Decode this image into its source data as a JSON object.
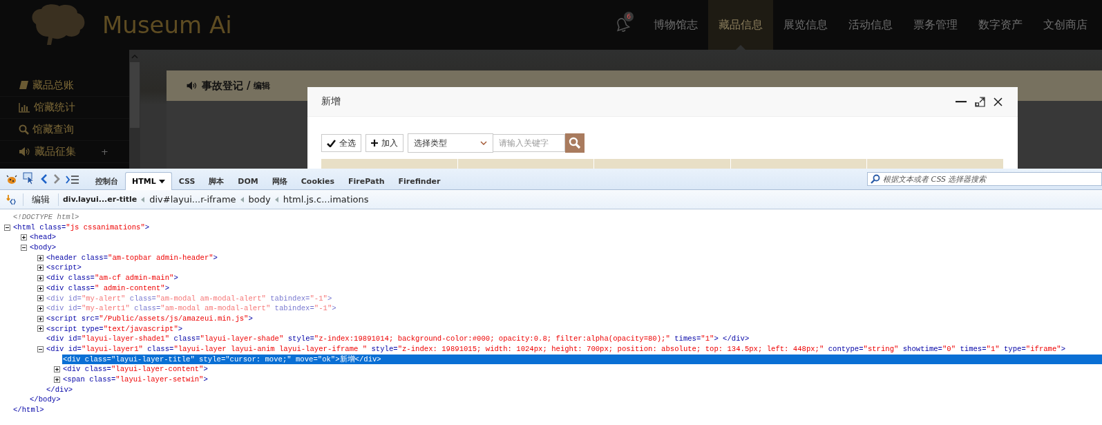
{
  "app": {
    "logo": "Museum Ai",
    "notification_count": "6",
    "nav": [
      {
        "label": "博物馆志",
        "selected": false
      },
      {
        "label": "藏品信息",
        "selected": true
      },
      {
        "label": "展览信息",
        "selected": false
      },
      {
        "label": "活动信息",
        "selected": false
      },
      {
        "label": "票务管理",
        "selected": false
      },
      {
        "label": "数字资产",
        "selected": false
      },
      {
        "label": "文创商店",
        "selected": false
      }
    ],
    "sidebar": [
      {
        "kind": "book",
        "label": "藏品总账"
      },
      {
        "kind": "chart",
        "label": "馆藏统计"
      },
      {
        "kind": "search",
        "label": "馆藏查询"
      },
      {
        "kind": "sound",
        "label": "藏品征集",
        "expander": "+"
      }
    ],
    "card": {
      "title": "事故登记",
      "separator": "/",
      "subtitle": "编辑"
    },
    "modal": {
      "title": "新增",
      "select_all": "全选",
      "add": "加入",
      "type_select": "选择类型",
      "keyword_placeholder": "请输入关键字"
    }
  },
  "devtools": {
    "tabs": [
      {
        "label": "控制台",
        "selected": false,
        "menu": false
      },
      {
        "label": "HTML",
        "selected": true,
        "menu": true
      },
      {
        "label": "CSS",
        "selected": false,
        "menu": false
      },
      {
        "label": "脚本",
        "selected": false,
        "menu": false
      },
      {
        "label": "DOM",
        "selected": false,
        "menu": false
      },
      {
        "label": "网络",
        "selected": false,
        "menu": false
      },
      {
        "label": "Cookies",
        "selected": false,
        "menu": false
      },
      {
        "label": "FirePath",
        "selected": false,
        "menu": false
      },
      {
        "label": "Firefinder",
        "selected": false,
        "menu": false
      }
    ],
    "search_placeholder": "根据文本或者 CSS 选择器搜索",
    "edit": "编辑",
    "breadcrumbs": [
      {
        "label": "div.layui...er-title",
        "selected": true
      },
      {
        "label": "div#layui...r-iframe",
        "selected": false
      },
      {
        "label": "body",
        "selected": false
      },
      {
        "label": "html.js.c...imations",
        "selected": false
      }
    ],
    "tree": [
      {
        "kind": "comment",
        "selected": false,
        "hidden": false,
        "tokens": [
          {
            "kind": "comment",
            "text": "<!DOCTYPE html>"
          }
        ]
      },
      {
        "kind": "element",
        "expanded": true,
        "selected": false,
        "hidden": false,
        "tokens": [
          {
            "kind": "tag",
            "text": "<html"
          },
          {
            "kind": "attr",
            "text": " class="
          },
          {
            "kind": "value",
            "text": "\"js cssanimations\""
          },
          {
            "kind": "tag",
            "text": ">"
          }
        ],
        "close": [
          {
            "kind": "tag",
            "text": "</html>"
          }
        ],
        "children": [
          {
            "kind": "element",
            "expanded": false,
            "selected": false,
            "hidden": false,
            "tokens": [
              {
                "kind": "tag",
                "text": "<head>"
              }
            ]
          },
          {
            "kind": "element",
            "expanded": true,
            "selected": false,
            "hidden": false,
            "tokens": [
              {
                "kind": "tag",
                "text": "<body>"
              }
            ],
            "close": [
              {
                "kind": "tag",
                "text": "</body>"
              }
            ],
            "children": [
              {
                "kind": "element",
                "expanded": false,
                "selected": false,
                "hidden": false,
                "tokens": [
                  {
                    "kind": "tag",
                    "text": "<header"
                  },
                  {
                    "kind": "attr",
                    "text": " class="
                  },
                  {
                    "kind": "value",
                    "text": "\"am-topbar admin-header\""
                  },
                  {
                    "kind": "tag",
                    "text": ">"
                  }
                ]
              },
              {
                "kind": "element",
                "expanded": false,
                "selected": false,
                "hidden": false,
                "tokens": [
                  {
                    "kind": "tag",
                    "text": "<script>"
                  }
                ]
              },
              {
                "kind": "element",
                "expanded": false,
                "selected": false,
                "hidden": false,
                "tokens": [
                  {
                    "kind": "tag",
                    "text": "<div"
                  },
                  {
                    "kind": "attr",
                    "text": " class="
                  },
                  {
                    "kind": "value",
                    "text": "\"am-cf admin-main\""
                  },
                  {
                    "kind": "tag",
                    "text": ">"
                  }
                ]
              },
              {
                "kind": "element",
                "expanded": false,
                "selected": false,
                "hidden": false,
                "tokens": [
                  {
                    "kind": "tag",
                    "text": "<div"
                  },
                  {
                    "kind": "attr",
                    "text": " class="
                  },
                  {
                    "kind": "value",
                    "text": "\" admin-content\""
                  },
                  {
                    "kind": "tag",
                    "text": ">"
                  }
                ]
              },
              {
                "kind": "element",
                "expanded": false,
                "selected": false,
                "hidden": true,
                "tokens": [
                  {
                    "kind": "tag",
                    "text": "<div"
                  },
                  {
                    "kind": "attr",
                    "text": " id="
                  },
                  {
                    "kind": "value",
                    "text": "\"my-alert\""
                  },
                  {
                    "kind": "attr",
                    "text": " class="
                  },
                  {
                    "kind": "value",
                    "text": "\"am-modal am-modal-alert\""
                  },
                  {
                    "kind": "attr",
                    "text": " tabindex="
                  },
                  {
                    "kind": "value",
                    "text": "\"-1\""
                  },
                  {
                    "kind": "tag",
                    "text": ">"
                  }
                ]
              },
              {
                "kind": "element",
                "expanded": false,
                "selected": false,
                "hidden": true,
                "tokens": [
                  {
                    "kind": "tag",
                    "text": "<div"
                  },
                  {
                    "kind": "attr",
                    "text": " id="
                  },
                  {
                    "kind": "value",
                    "text": "\"my-alert1\""
                  },
                  {
                    "kind": "attr",
                    "text": " class="
                  },
                  {
                    "kind": "value",
                    "text": "\"am-modal am-modal-alert\""
                  },
                  {
                    "kind": "attr",
                    "text": " tabindex="
                  },
                  {
                    "kind": "value",
                    "text": "\"-1\""
                  },
                  {
                    "kind": "tag",
                    "text": ">"
                  }
                ]
              },
              {
                "kind": "element",
                "expanded": false,
                "selected": false,
                "hidden": false,
                "tokens": [
                  {
                    "kind": "tag",
                    "text": "<script"
                  },
                  {
                    "kind": "attr",
                    "text": " src="
                  },
                  {
                    "kind": "value",
                    "text": "\"/Public/assets/js/amazeui.min.js\""
                  },
                  {
                    "kind": "tag",
                    "text": ">"
                  }
                ]
              },
              {
                "kind": "element",
                "expanded": false,
                "selected": false,
                "hidden": false,
                "tokens": [
                  {
                    "kind": "tag",
                    "text": "<script"
                  },
                  {
                    "kind": "attr",
                    "text": " type="
                  },
                  {
                    "kind": "value",
                    "text": "\"text/javascript\""
                  },
                  {
                    "kind": "tag",
                    "text": ">"
                  }
                ]
              },
              {
                "kind": "leaf",
                "selected": false,
                "hidden": false,
                "tokens": [
                  {
                    "kind": "tag",
                    "text": "<div"
                  },
                  {
                    "kind": "attr",
                    "text": " id="
                  },
                  {
                    "kind": "value",
                    "text": "\"layui-layer-shade1\""
                  },
                  {
                    "kind": "attr",
                    "text": " class="
                  },
                  {
                    "kind": "value",
                    "text": "\"layui-layer-shade\""
                  },
                  {
                    "kind": "attr",
                    "text": " style="
                  },
                  {
                    "kind": "value",
                    "text": "\"z-index:19891014; background-color:#000; opacity:0.8; filter:alpha(opacity=80);\""
                  },
                  {
                    "kind": "attr",
                    "text": " times="
                  },
                  {
                    "kind": "value",
                    "text": "\"1\""
                  },
                  {
                    "kind": "tag",
                    "text": "> </div>"
                  }
                ]
              },
              {
                "kind": "element",
                "expanded": true,
                "selected": false,
                "hidden": false,
                "tokens": [
                  {
                    "kind": "tag",
                    "text": "<div"
                  },
                  {
                    "kind": "attr",
                    "text": " id="
                  },
                  {
                    "kind": "value",
                    "text": "\"layui-layer1\""
                  },
                  {
                    "kind": "attr",
                    "text": " class="
                  },
                  {
                    "kind": "value",
                    "text": "\"layui-layer layui-anim layui-layer-iframe \""
                  },
                  {
                    "kind": "attr",
                    "text": " style="
                  },
                  {
                    "kind": "value",
                    "text": "\"z-index: 19891015; width: 1024px; height: 700px; position: absolute; top: 134.5px; left: 448px;\""
                  },
                  {
                    "kind": "attr",
                    "text": " contype="
                  },
                  {
                    "kind": "value",
                    "text": "\"string\""
                  },
                  {
                    "kind": "attr",
                    "text": " showtime="
                  },
                  {
                    "kind": "value",
                    "text": "\"0\""
                  },
                  {
                    "kind": "attr",
                    "text": " times="
                  },
                  {
                    "kind": "value",
                    "text": "\"1\""
                  },
                  {
                    "kind": "attr",
                    "text": " type="
                  },
                  {
                    "kind": "value",
                    "text": "\"iframe\""
                  },
                  {
                    "kind": "tag",
                    "text": ">"
                  }
                ],
                "close": [
                  {
                    "kind": "tag",
                    "text": "</div>"
                  }
                ],
                "children": [
                  {
                    "kind": "leaf",
                    "selected": true,
                    "hidden": false,
                    "tokens": [
                      {
                        "kind": "tag",
                        "text": "<div"
                      },
                      {
                        "kind": "attr",
                        "text": " class="
                      },
                      {
                        "kind": "value",
                        "text": "\"layui-layer-title\""
                      },
                      {
                        "kind": "attr",
                        "text": " style="
                      },
                      {
                        "kind": "value",
                        "text": "\"cursor: move;\""
                      },
                      {
                        "kind": "attr",
                        "text": " move="
                      },
                      {
                        "kind": "value",
                        "text": "\"ok\""
                      },
                      {
                        "kind": "tag",
                        "text": ">"
                      },
                      {
                        "kind": "text",
                        "text": "新增"
                      },
                      {
                        "kind": "tag",
                        "text": "</div>"
                      }
                    ]
                  },
                  {
                    "kind": "element",
                    "expanded": false,
                    "selected": false,
                    "hidden": false,
                    "tokens": [
                      {
                        "kind": "tag",
                        "text": "<div"
                      },
                      {
                        "kind": "attr",
                        "text": " class="
                      },
                      {
                        "kind": "value",
                        "text": "\"layui-layer-content\""
                      },
                      {
                        "kind": "tag",
                        "text": ">"
                      }
                    ]
                  },
                  {
                    "kind": "element",
                    "expanded": false,
                    "selected": false,
                    "hidden": false,
                    "tokens": [
                      {
                        "kind": "tag",
                        "text": "<span"
                      },
                      {
                        "kind": "attr",
                        "text": " class="
                      },
                      {
                        "kind": "value",
                        "text": "\"layui-layer-setwin\""
                      },
                      {
                        "kind": "tag",
                        "text": ">"
                      }
                    ]
                  }
                ]
              }
            ]
          }
        ]
      }
    ]
  }
}
